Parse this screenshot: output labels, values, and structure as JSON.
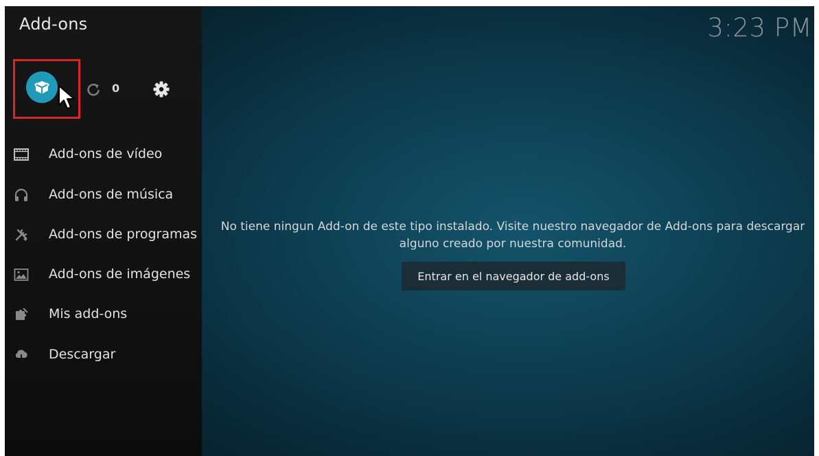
{
  "header": {
    "title": "Add-ons",
    "clock": "3:23 PM"
  },
  "toolbar": {
    "package_icon": "open-box-icon",
    "update_count": "0"
  },
  "menu": [
    {
      "label": "Add-ons de vídeo",
      "icon": "film-strip-icon"
    },
    {
      "label": "Add-ons de música",
      "icon": "headphones-icon"
    },
    {
      "label": "Add-ons de programas",
      "icon": "tools-icon"
    },
    {
      "label": "Add-ons de imágenes",
      "icon": "picture-icon"
    },
    {
      "label": "Mis add-ons",
      "icon": "puzzle-icon"
    },
    {
      "label": "Descargar",
      "icon": "cloud-download-icon"
    }
  ],
  "main": {
    "message": "No tiene ningun Add-on de este tipo instalado. Visite nuestro navegador de Add-ons para descargar alguno creado por nuestra comunidad.",
    "browse_button": "Entrar en el navegador de add-ons"
  },
  "colors": {
    "accent": "#1f9ab8",
    "highlight": "#d8262b"
  }
}
